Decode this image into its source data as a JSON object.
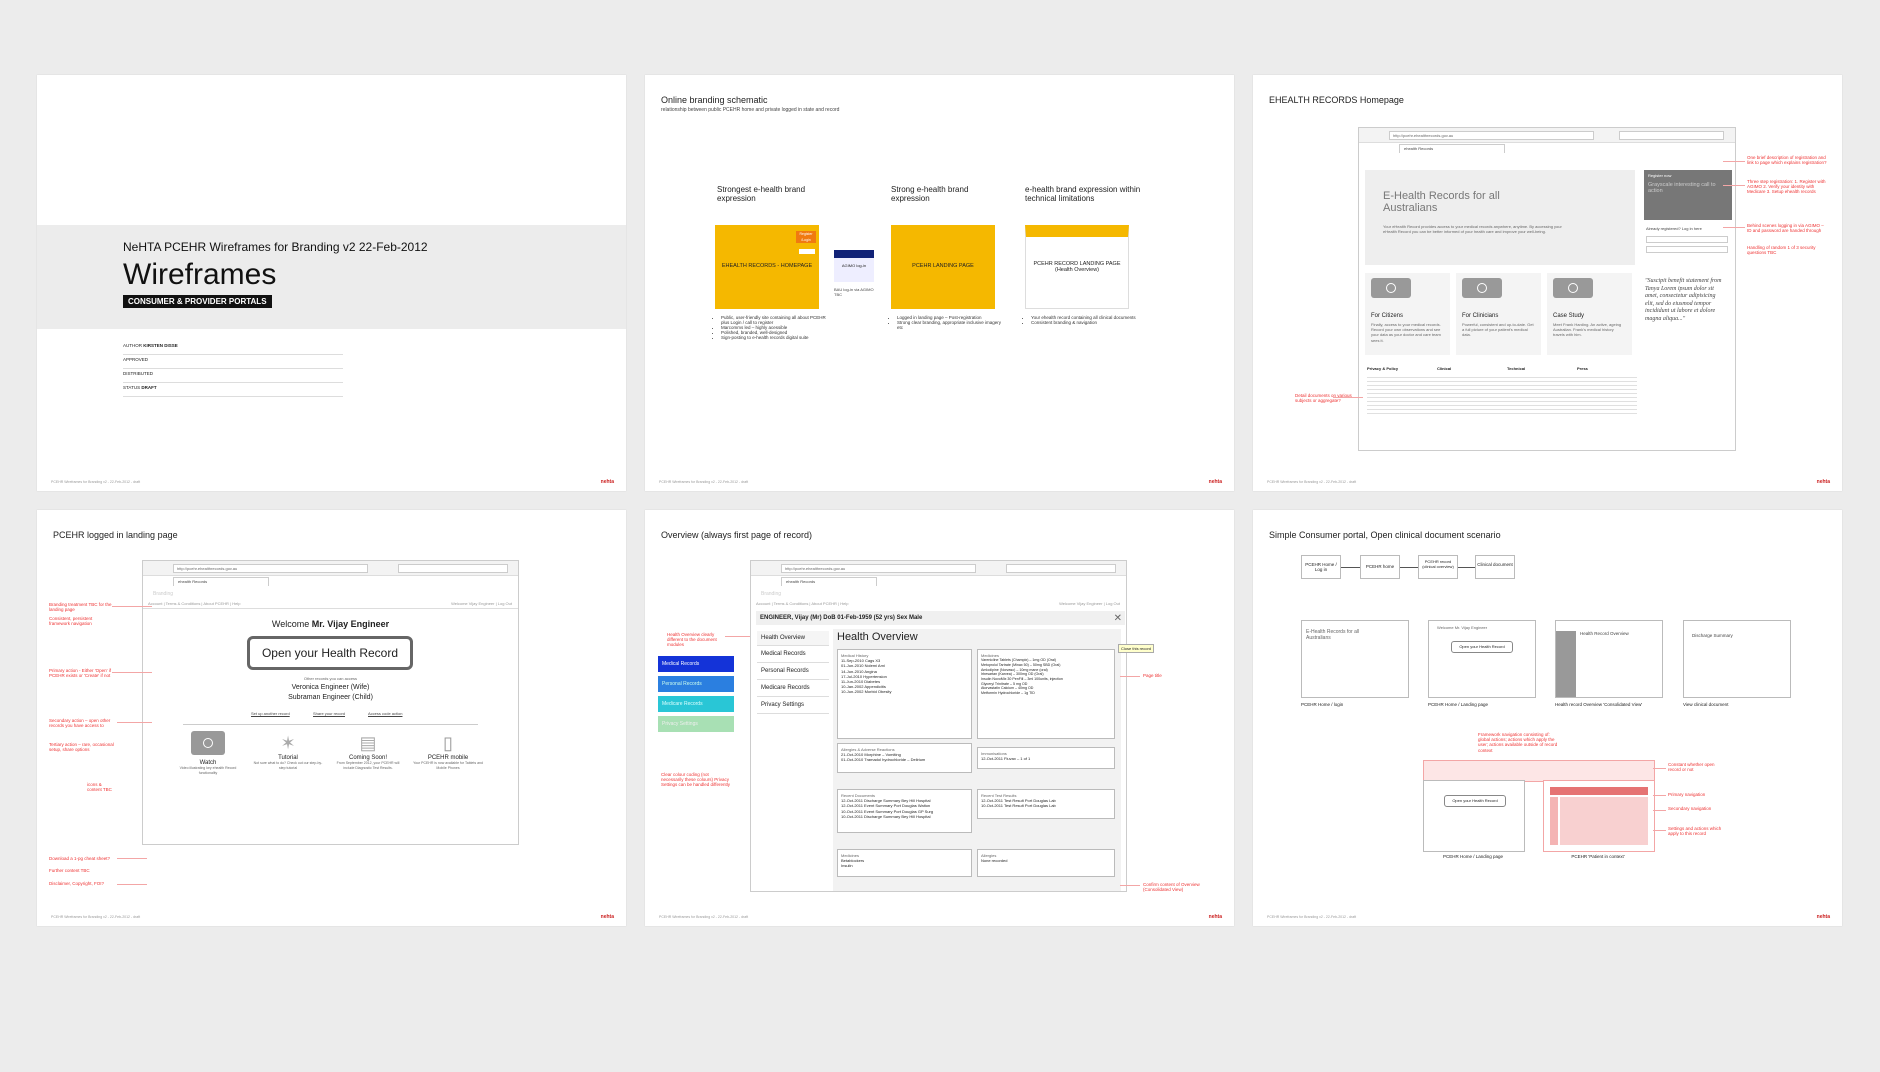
{
  "footer_text": "PCEHR Wireframes for Branding v2 - 22-Feb-2012 - draft",
  "footer_logo": "nehta",
  "slide1": {
    "header": "NeHTA PCEHR Wireframes for Branding v2  22-Feb-2012",
    "title": "Wireframes",
    "badge": "CONSUMER & PROVIDER PORTALS",
    "meta": [
      {
        "label": "AUTHOR",
        "value": "KIRSTEN DISSE"
      },
      {
        "label": "APPROVED",
        "value": ""
      },
      {
        "label": "DISTRIBUTED",
        "value": ""
      },
      {
        "label": "STATUS",
        "value": "DRAFT"
      }
    ]
  },
  "slide2": {
    "title": "Online branding schematic",
    "subtitle": "relationship between public PCEHR home and private logged in state and record",
    "col1_title": "Strongest e-health brand expression",
    "col2_title": "Strong e-health brand expression",
    "col3_title": "e-health brand expression within technical limitations",
    "box1_label": "EHEALTH RECORDS - HOMEPAGE",
    "box1_tag": "Register /Login",
    "agimo_label": "AGIMO log-in",
    "agimo_note": "BAU log-in via AGIMO TBC",
    "box2_label": "PCEHR LANDING PAGE",
    "box3_label": "PCEHR RECORD LANDING PAGE (Health Overview)",
    "col1_bullets": [
      "Public, user-friendly site containing all about PCEHR plus Login / call to register",
      "Marcomms led – highly acessible",
      "Polished, branded, well-designed",
      "Sign-posting to e-health records digital suite"
    ],
    "col2_bullets": [
      "Logged in landing page – Post-registration",
      "Strong clear branding, appropriate inclusive imagery etc"
    ],
    "col3_bullets": [
      "Your ehealth record containing all clinical documents",
      "Consistent branding & navigation"
    ]
  },
  "slide3": {
    "title": "EHEALTH RECORDS Homepage",
    "url": "http://pcehr.ehealthrecords.gov.au",
    "tab": "ehealth Records",
    "hero_title": "E-Health Records for all Australians",
    "hero_body": "Your eHealth Record provides access to your medical records anywhere, anytime. By accessing your eHealth Record you can be better informed of your health care and improve your well-being.",
    "register_title": "Register now",
    "register_body": "Grayscale interesting call to action",
    "login_label": "Already registered? Log in here",
    "cards": [
      {
        "title": "For Citizens",
        "body": "Finally, access to your medical records. Record your own observations and see your data as your doctor and care team sees it."
      },
      {
        "title": "For Clinicians",
        "body": "Powerful, consistent and up-to-date. Get a full picture of your patient's medical data."
      },
      {
        "title": "Case Study",
        "body": "Meet Frank Harding. An active, ageing Australian. Frank's medical history travels with him."
      }
    ],
    "quote": "\"Suscipit benefit statement from Tanya Lorem ipsum dolor sit amet, consectetur adipisicing elit, sed do eiusmod tempor incididunt ut labore et dolore magna aliqua...\"",
    "link_cols": [
      "Privacy & Policy",
      "Clinical",
      "Technical",
      "Press"
    ],
    "notes": [
      "One brief description of registration and link to page which explains registration?",
      "Three step registration: 1. Register with AGIMO 2. Verify your identity with Medicare 3. Setup ehealth records",
      "Behind scenes logging in via AGIMO – ID and password are handed through",
      "Handling of random 1 of 3 security questions TBC",
      "Detail documents on various subjects or aggregate?"
    ]
  },
  "slide4": {
    "title": "PCEHR logged in landing page",
    "url": "http://pcehr.ehealthrecords.gov.au",
    "tab": "ehealth Records",
    "branding": "Branding",
    "crumbs": "Account  |  Terms & Conditions  |  About PCEHR  |  Help",
    "user_links": "Welcome Vijay Engineer  |  Log Out",
    "welcome": "Welcome",
    "user_name": "Mr. Vijay Engineer",
    "open_button": "Open your Health Record",
    "other_label": "Other records you can access",
    "other_records": [
      "Veronica Engineer (Wife)",
      "Subraman Engineer (Child)"
    ],
    "sub_links": [
      "Set up another record",
      "Share your record",
      "Access code action"
    ],
    "tiles": [
      {
        "title": "Watch",
        "body": "Video illustrating key ehealth Record functionality"
      },
      {
        "title": "Tutorial",
        "body": "Not sure what to do? Check out our step-by-step tutorial"
      },
      {
        "title": "Coming Soon!",
        "body": "From September 2012, your PCEHR will include Diagnostic Test Results."
      },
      {
        "title": "PCEHR mobile",
        "body": "Your PCEHR is now available for Tablets and Mobile Phones"
      }
    ],
    "notes": [
      "Branding treatment TBC for the landing page",
      "Consistent, persistent framework navigation",
      "Primary action - Either 'Open' if PCEHR exists or 'Create' if not",
      "Secondary action – open other records you have access to",
      "Tertiary action – rare, occasional setup, share options",
      "icons & content TBC",
      "Download a 1-pg cheat sheet?",
      "Further content TBC",
      "Disclaimer, Copyright, FOI?"
    ]
  },
  "slide5": {
    "title": "Overview (always first page of record)",
    "url": "http://pcehr.ehealthrecords.gov.au",
    "tab": "ehealth Records",
    "branding": "Branding",
    "crumbs": "Account  |  Terms & Conditions  |  About PCEHR  |  Help",
    "user_links": "Welcome Vijay Engineer  |  Log Out",
    "patient": "ENGINEER, Vijay (Mr)  DoB 01-Feb-1959 (52 yrs)  Sex Male",
    "close_label": "Close this record",
    "nav": [
      "Health Overview",
      "Medical Records",
      "Personal Records",
      "Medicare Records",
      "Privacy Settings"
    ],
    "color_nav": [
      "Medical Records",
      "Personal Records",
      "Medicare Records",
      "Privacy Settings"
    ],
    "heading": "Health Overview",
    "panels": {
      "history_title": "Medical History",
      "history": [
        "11-Sep-2010  Cags X3",
        "01-Jun-2010  Nolemi Ami",
        "14-Jun-2010  Angina",
        "17-Jul-2010  Hypertension",
        "11-Jun-2010  Diabetes",
        "10-Jan-2002  Appendicitis",
        "10-Jun-2002  Morbid Obesity"
      ],
      "meds_title": "Medicines",
      "meds": [
        "Varenicline Tablets (Champix) – 1mg OD (Oral)",
        "Metoprolol Tartrate (Minax 50) – 50mg SBD (Oral)",
        "Amlodipine (Norvasc) – 10mg mane (oral)",
        "Irbesartan (Karvea) – 300mg OD (Oral)",
        "Insulin NovoMix 30 PenFill – 3ml 100units, injection",
        "Glyceryl Trinitrate – 5 mg OD",
        "Atorvastatin Calcium – 40mg OD",
        "Metformin Hydrochloride – 1g TID"
      ],
      "allergy_title": "Allergies & Adverse Reactions",
      "allergies": [
        "21-Oct-2010  Morphine – Vomiting",
        "01-Oct-2010  Tramadol hydrochloride – Delirium"
      ],
      "immun_title": "Immunisations",
      "immun": [
        "12-Oct-2011  Fluvax – 1 of 1"
      ],
      "docs_title": "Recent Documents",
      "docs": [
        "12-Oct-2011  Discharge Summary Bey Hill Hospital",
        "12-Oct-2011  Event Summary Port Douglas Walton",
        "10-Oct-2011  Event Summary Port Douglas GP Surg",
        "10-Oct-2011  Discharge Summary Bey Hill Hospital"
      ],
      "tests_title": "Recent Test Results",
      "tests": [
        "12-Oct-2011  Test Result Port Douglas Lab",
        "10-Oct-2011  Test Result Port Douglas Lab"
      ],
      "med2_title": "Medicines",
      "med2": [
        "Betablockers",
        "Insulin"
      ],
      "alg2_title": "Allergies",
      "alg2": [
        "None recorded"
      ]
    },
    "notes": [
      "Health Overview clearly different to the document modules",
      "Clear colour coding (not necessarily these colours) Privacy Settings can be handled differently",
      "Page title",
      "Confirm content of Overview (Consolidated View)"
    ]
  },
  "slide6": {
    "title": "Simple Consumer portal, Open clinical document scenario",
    "flow": [
      "PCEHR Home / Log in",
      "PCEHR home",
      "PCEHR record (clinical overview)",
      "Clinical document"
    ],
    "thumbs": [
      {
        "caption": "PCEHR Home / login",
        "head": "E-Health Records for all Australians"
      },
      {
        "caption": "PCEHR Home / Landing page",
        "head": "Welcome Mr. Vijay Engineer"
      },
      {
        "caption": "Health record Overview 'Consolidated View'",
        "head": "Health Record Overview"
      },
      {
        "caption": "View clinical document",
        "head": "Discharge Summary"
      }
    ],
    "open_button": "Open your Health Record",
    "bottom_captions": [
      "PCEHR Home / Landing page",
      "PCEHR 'Patient in context'"
    ],
    "notes": [
      "Framework navigation consisting of: global actions; actions which apply the user; actions available outside of record context",
      "Constant whether open record or not",
      "Primary navigation",
      "Secondary navigation",
      "Settings and actions which apply to this record"
    ]
  },
  "colors": {
    "accent_yellow": "#f5b800",
    "nav_blue": "#1433d8",
    "nav_blue2": "#2b7fe0",
    "nav_cyan": "#29c6d6",
    "nav_green": "#a8e0b4",
    "note_red": "#e33333"
  }
}
